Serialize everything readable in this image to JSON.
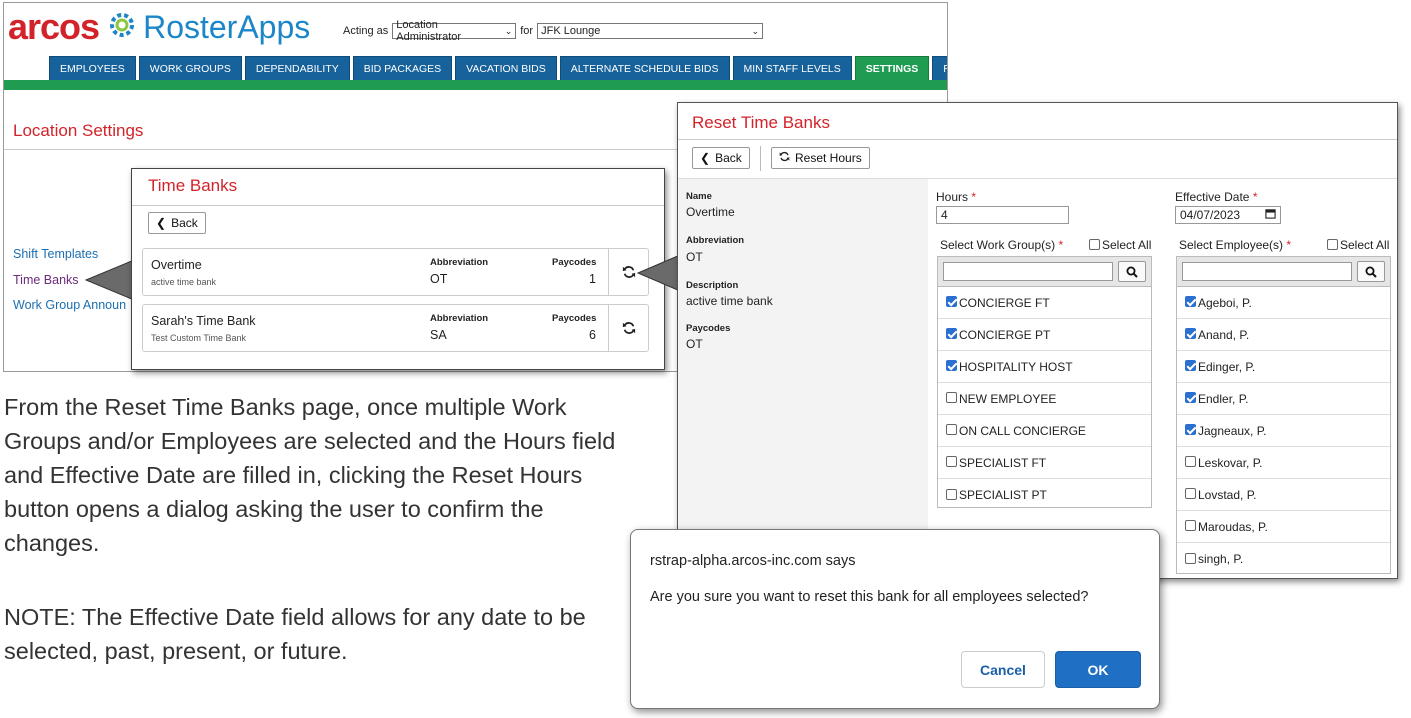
{
  "header": {
    "logo_arcos": "arcos",
    "logo_roster": "RosterApps",
    "acting_as_label": "Acting as",
    "acting_as_value": "Location Administrator",
    "for_label": "for",
    "location_value": "JFK Lounge"
  },
  "nav": {
    "tabs": [
      {
        "label": "EMPLOYEES"
      },
      {
        "label": "WORK GROUPS"
      },
      {
        "label": "DEPENDABILITY"
      },
      {
        "label": "BID PACKAGES"
      },
      {
        "label": "VACATION BIDS"
      },
      {
        "label": "ALTERNATE SCHEDULE BIDS"
      },
      {
        "label": "MIN STAFF LEVELS"
      },
      {
        "label": "SETTINGS",
        "active": true
      },
      {
        "label": "REPORTS"
      }
    ]
  },
  "location": {
    "title": "Location Settings",
    "links": [
      "Shift Templates",
      "Time Banks",
      "Work Group Announ"
    ]
  },
  "time_banks": {
    "title": "Time Banks",
    "back_label": "Back",
    "col_abbreviation": "Abbreviation",
    "col_paycodes": "Paycodes",
    "banks": [
      {
        "name": "Overtime",
        "description": "active time bank",
        "abbreviation": "OT",
        "paycodes": "1"
      },
      {
        "name": "Sarah's Time Bank",
        "description": "Test Custom Time Bank",
        "abbreviation": "SA",
        "paycodes": "6"
      }
    ]
  },
  "reset": {
    "title": "Reset Time Banks",
    "back_label": "Back",
    "reset_label": "Reset Hours",
    "info": {
      "name_label": "Name",
      "name_value": "Overtime",
      "abbr_label": "Abbreviation",
      "abbr_value": "OT",
      "desc_label": "Description",
      "desc_value": "active time bank",
      "paycodes_label": "Paycodes",
      "paycodes_value": "OT"
    },
    "hours_label": "Hours",
    "hours_value": "4",
    "date_label": "Effective Date",
    "date_value": "04/07/2023",
    "required_mark": "*",
    "wg_label": "Select Work Group(s)",
    "emp_label": "Select Employee(s)",
    "select_all_label": "Select All",
    "work_groups": [
      {
        "label": "CONCIERGE FT",
        "checked": true
      },
      {
        "label": "CONCIERGE PT",
        "checked": true
      },
      {
        "label": "HOSPITALITY HOST",
        "checked": true
      },
      {
        "label": "NEW EMPLOYEE",
        "checked": false
      },
      {
        "label": "ON CALL CONCIERGE",
        "checked": false
      },
      {
        "label": "SPECIALIST FT",
        "checked": false
      },
      {
        "label": "SPECIALIST PT",
        "checked": false
      }
    ],
    "employees": [
      {
        "label": "Ageboi, P.",
        "checked": true
      },
      {
        "label": "Anand, P.",
        "checked": true
      },
      {
        "label": "Edinger, P.",
        "checked": true
      },
      {
        "label": "Endler, P.",
        "checked": true
      },
      {
        "label": "Jagneaux, P.",
        "checked": true
      },
      {
        "label": "Leskovar, P.",
        "checked": false
      },
      {
        "label": "Lovstad, P.",
        "checked": false
      },
      {
        "label": "Maroudas,  P.",
        "checked": false
      },
      {
        "label": "singh, P.",
        "checked": false
      }
    ]
  },
  "explanation": {
    "paragraph1": "From the Reset Time Banks page, once multiple Work Groups and/or Employees are selected and the Hours field and Effective Date are filled in, clicking the Reset Hours button opens a dialog asking the user to confirm the changes.",
    "paragraph2": "NOTE: The Effective Date field allows for any date to be selected, past, present, or future."
  },
  "dialog": {
    "origin": "rstrap-alpha.arcos-inc.com says",
    "message": "Are you sure you want to reset this bank for all employees selected?",
    "cancel_label": "Cancel",
    "ok_label": "OK"
  },
  "colors": {
    "brand_red": "#d2232a",
    "brand_blue": "#1c86c8",
    "nav_blue": "#17629b",
    "nav_green": "#1f9b52",
    "checkbox_blue": "#2b6fd0",
    "ok_blue": "#1f6fc4"
  }
}
